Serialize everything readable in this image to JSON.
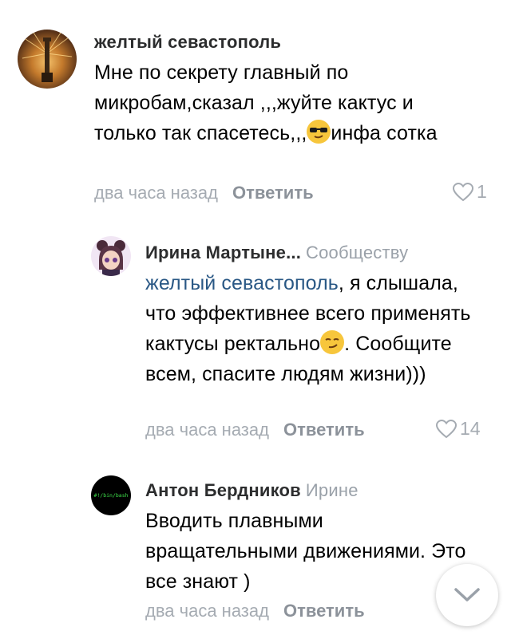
{
  "comments": [
    {
      "author": "желтый севастополь",
      "to": "",
      "text_parts": [
        "Мне по секрету главный по микробам,сказал ,,,жуйте кактус и только так спасетесь,,,",
        "инфа сотка"
      ],
      "emoji": "sunglasses-face",
      "time": "два часа назад",
      "reply": "Ответить",
      "likes": "1"
    },
    {
      "author": "Ирина Мартыне...",
      "to": "Сообществу",
      "mention": "желтый севастополь",
      "text_parts": [
        ", я слышала, что эффективнее всего применять кактусы ректально",
        ". Сообщите всем, спасите людям жизни)))"
      ],
      "emoji": "smirking-face",
      "time": "два часа назад",
      "reply": "Ответить",
      "likes": "14"
    },
    {
      "author": "Антон Бердников",
      "to": "Ирине",
      "avatar_text": "#!/bin/bash",
      "text": "Вводить плавными вращательными движениями. Это все знают )",
      "time": "два часа назад",
      "reply": "Ответить"
    }
  ],
  "colors": {
    "mention": "#2a5885",
    "meta": "#a5abb2",
    "name": "#2c2d2e"
  },
  "scroll_button_icon": "chevron-down-icon"
}
